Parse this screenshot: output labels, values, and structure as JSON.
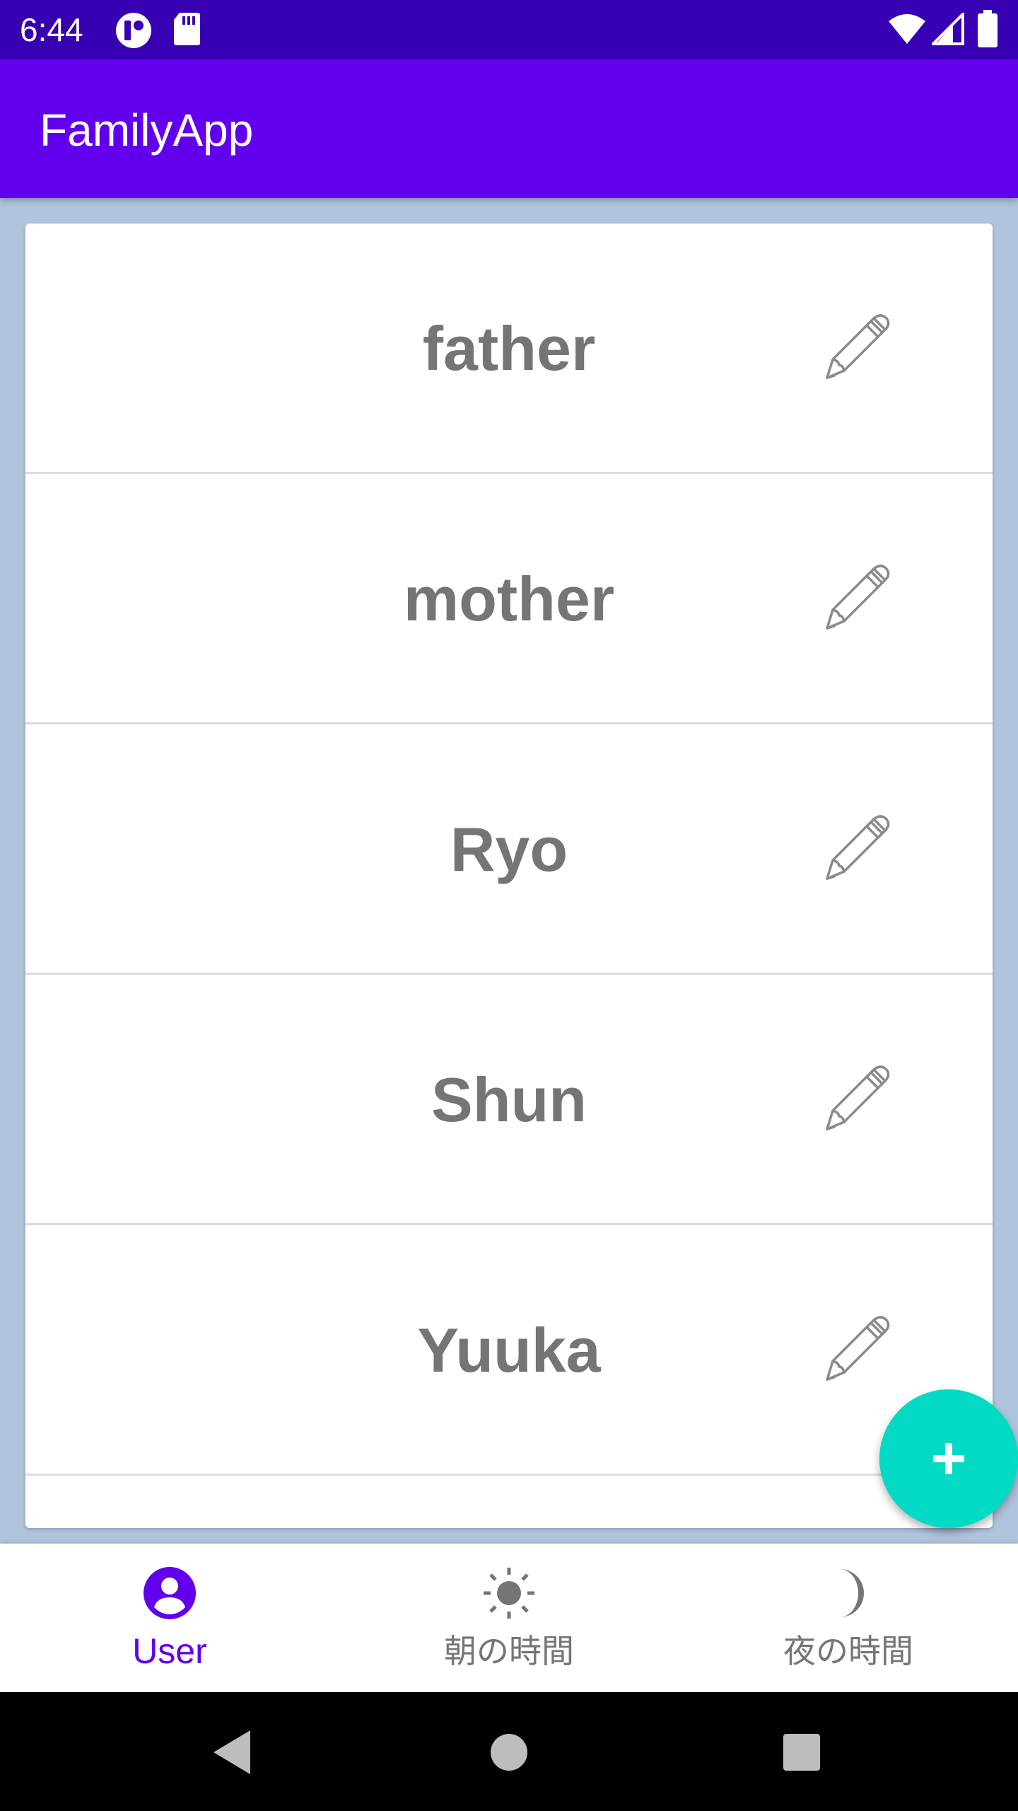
{
  "status_bar": {
    "time": "6:44"
  },
  "app_bar": {
    "title": "FamilyApp"
  },
  "users": [
    {
      "name": "father"
    },
    {
      "name": "mother"
    },
    {
      "name": "Ryo"
    },
    {
      "name": "Shun"
    },
    {
      "name": "Yuuka"
    }
  ],
  "bottom_nav": {
    "items": [
      {
        "label": "User",
        "icon": "account-circle-icon",
        "active": true
      },
      {
        "label": "朝の時間",
        "icon": "sun-icon",
        "active": false
      },
      {
        "label": "夜の時間",
        "icon": "moon-icon",
        "active": false
      }
    ]
  },
  "colors": {
    "primary": "#6200ee",
    "primary_dark": "#3700b3",
    "accent": "#03dac5",
    "background": "#b1c4dd",
    "text_secondary": "#757575"
  }
}
